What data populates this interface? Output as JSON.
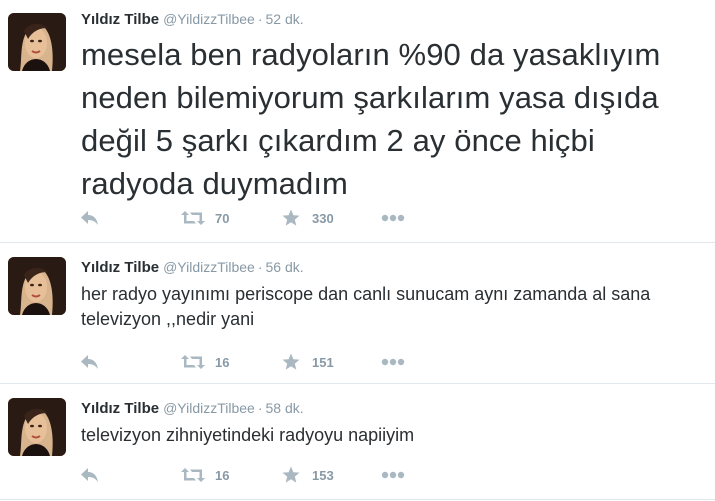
{
  "tweets": [
    {
      "fullname": "Yıldız Tilbe",
      "username": "@YildizzTilbee",
      "separator": "·",
      "time": "52 dk.",
      "text": "mesela ben radyoların %90 da yasaklıyım neden bilemiyorum şarkılarım yasa dışıda değil 5 şarkı çıkardım 2 ay önce hiçbi radyoda duymadım",
      "retweets": "70",
      "favorites": "330"
    },
    {
      "fullname": "Yıldız Tilbe",
      "username": "@YildizzTilbee",
      "separator": "·",
      "time": "56 dk.",
      "text": "her radyo yayınımı periscope dan canlı sunucam aynı zamanda al sana televizyon ,,nedir yani",
      "retweets": "16",
      "favorites": "151"
    },
    {
      "fullname": "Yıldız Tilbe",
      "username": "@YildizzTilbee",
      "separator": "·",
      "time": "58 dk.",
      "text": "televizyon zihniyetindeki radyoyu napiiyim",
      "retweets": "16",
      "favorites": "153"
    }
  ],
  "icons": {
    "reply": "reply-icon",
    "retweet": "retweet-icon",
    "favorite": "star-icon",
    "more": "more-dots-icon"
  },
  "colors": {
    "text": "#292f33",
    "muted": "#8899a6",
    "icon": "#aab8c2",
    "divider": "#e1e8ed"
  }
}
